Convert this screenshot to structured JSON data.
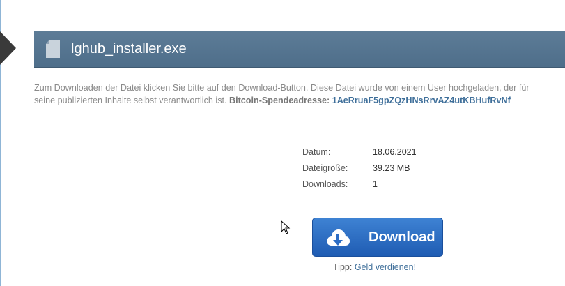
{
  "header": {
    "file_name": "lghub_installer.exe"
  },
  "description": {
    "text_part1": "Zum Downloaden der Datei klicken Sie bitte auf den Download-Button. Diese Datei wurde von einem User hochgeladen, der für",
    "text_part2": "seine publizierten Inhalte selbst verantwortlich ist.",
    "bitcoin_label": "Bitcoin-Spendeadresse:",
    "bitcoin_address": "1AeRruaF5gpZQzHNsRrvAZ4utKBHufRvNf"
  },
  "meta": {
    "rows": [
      {
        "key": "Datum:",
        "value": "18.06.2021"
      },
      {
        "key": "Dateigröße:",
        "value": "39.23 MB"
      },
      {
        "key": "Downloads:",
        "value": "1"
      }
    ]
  },
  "download_button": {
    "label": "Download",
    "icon": "cloud-download-icon"
  },
  "tip": {
    "prefix": "Tipp:",
    "link": "Geld verdienen!"
  },
  "colors": {
    "header_bg": "#52718c",
    "button_bg": "#2b6cc4",
    "link": "#3f6f9a"
  }
}
